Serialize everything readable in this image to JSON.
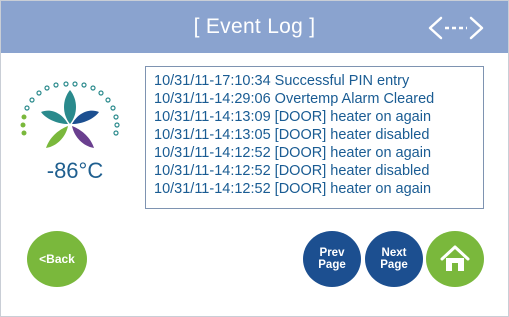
{
  "header": {
    "title": "[ Event Log ]",
    "nav_icon": "double-arrow-icon"
  },
  "status": {
    "temperature": "-86°C"
  },
  "log": {
    "entries": [
      "10/31/11-17:10:34 Successful PIN entry",
      "10/31/11-14:29:06 Overtemp Alarm Cleared",
      "10/31/11-14:13:09 [DOOR] heater on again",
      "10/31/11-14:13:05 [DOOR] heater disabled",
      "10/31/11-14:12:52 [DOOR] heater on again",
      "10/31/11-14:12:52 [DOOR] heater disabled",
      "10/31/11-14:12:52 [DOOR] heater on again"
    ]
  },
  "buttons": {
    "back_label": "<Back",
    "prev_line1": "Prev",
    "prev_line2": "Page",
    "next_line1": "Next",
    "next_line2": "Page",
    "home_icon": "home-icon"
  },
  "colors": {
    "header": "#8aa3cf",
    "green": "#7ab83c",
    "navy": "#1c4f90",
    "teal": "#2a8a8c",
    "purple": "#6a3f8f",
    "text": "#1a5c93"
  }
}
